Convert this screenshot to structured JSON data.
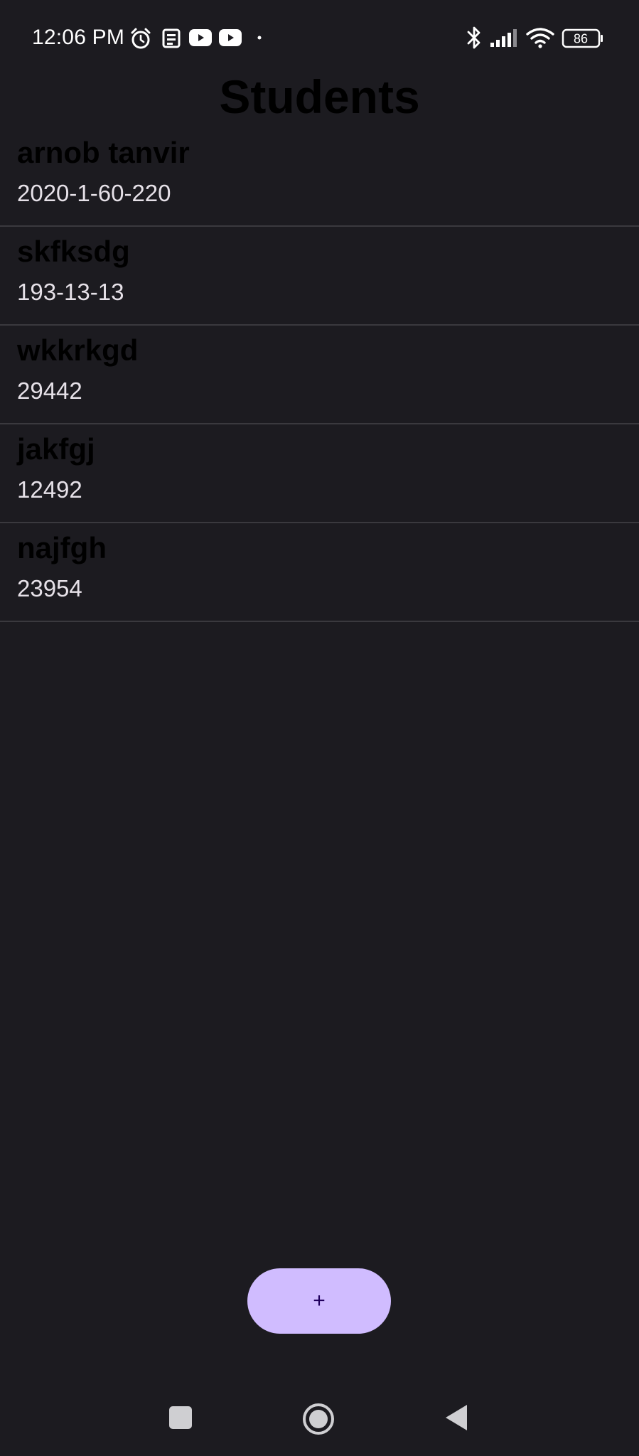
{
  "status_bar": {
    "time": "12:06 PM",
    "battery_level": "86",
    "icons": [
      "alarm-icon",
      "news-icon",
      "youtube-icon",
      "youtube-icon",
      "dot-icon",
      "bluetooth-icon",
      "signal-icon",
      "wifi-icon",
      "battery-icon"
    ]
  },
  "page": {
    "title": "Students"
  },
  "students": [
    {
      "name": "arnob tanvir",
      "id": "2020-1-60-220"
    },
    {
      "name": "skfksdg",
      "id": "193-13-13"
    },
    {
      "name": "wkkrkgd",
      "id": "29442"
    },
    {
      "name": "jakfgj",
      "id": "12492"
    },
    {
      "name": "najfgh",
      "id": "23954"
    }
  ],
  "fab": {
    "label": "+"
  },
  "nav": {
    "buttons": [
      "recents-button",
      "home-button",
      "back-button"
    ]
  },
  "colors": {
    "background": "#1c1b20",
    "fab": "#d0bcff",
    "fab_text": "#21005d",
    "divider": "#3a393e"
  }
}
